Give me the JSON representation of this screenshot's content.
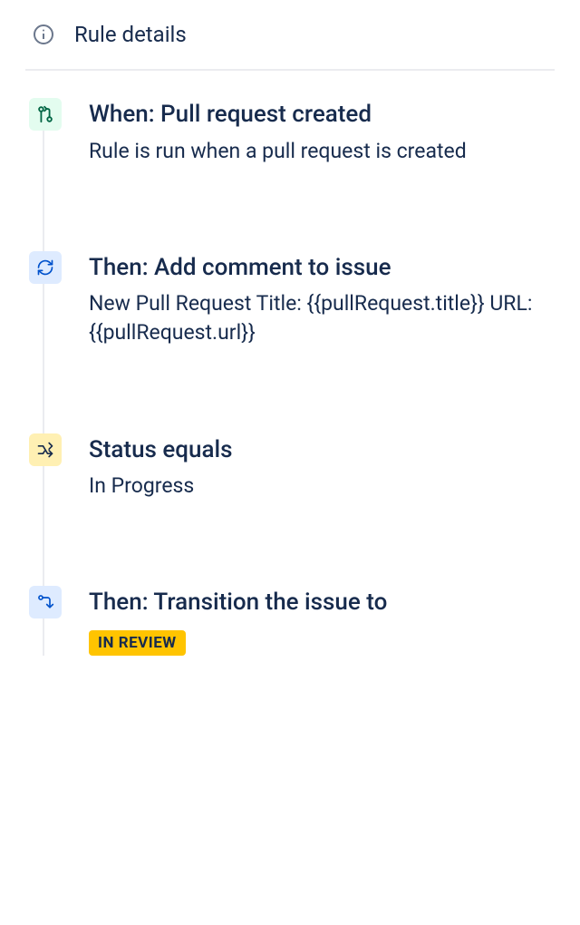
{
  "header": {
    "title": "Rule details"
  },
  "steps": [
    {
      "icon": "pull-request",
      "icon_bg": "green",
      "title": "When: Pull request created",
      "body_type": "text",
      "body": "Rule is run when a pull request is created"
    },
    {
      "icon": "refresh",
      "icon_bg": "blue",
      "title": "Then: Add comment to issue",
      "body_type": "text",
      "body": "New Pull Request Title: {{pullRequest.title}} URL: {{pullRequest.url}}"
    },
    {
      "icon": "shuffle",
      "icon_bg": "yellow",
      "title": "Status equals",
      "body_type": "text",
      "body": "In Progress"
    },
    {
      "icon": "transition",
      "icon_bg": "blue",
      "title": "Then: Transition the issue to",
      "body_type": "lozenge",
      "body": "IN REVIEW"
    }
  ]
}
